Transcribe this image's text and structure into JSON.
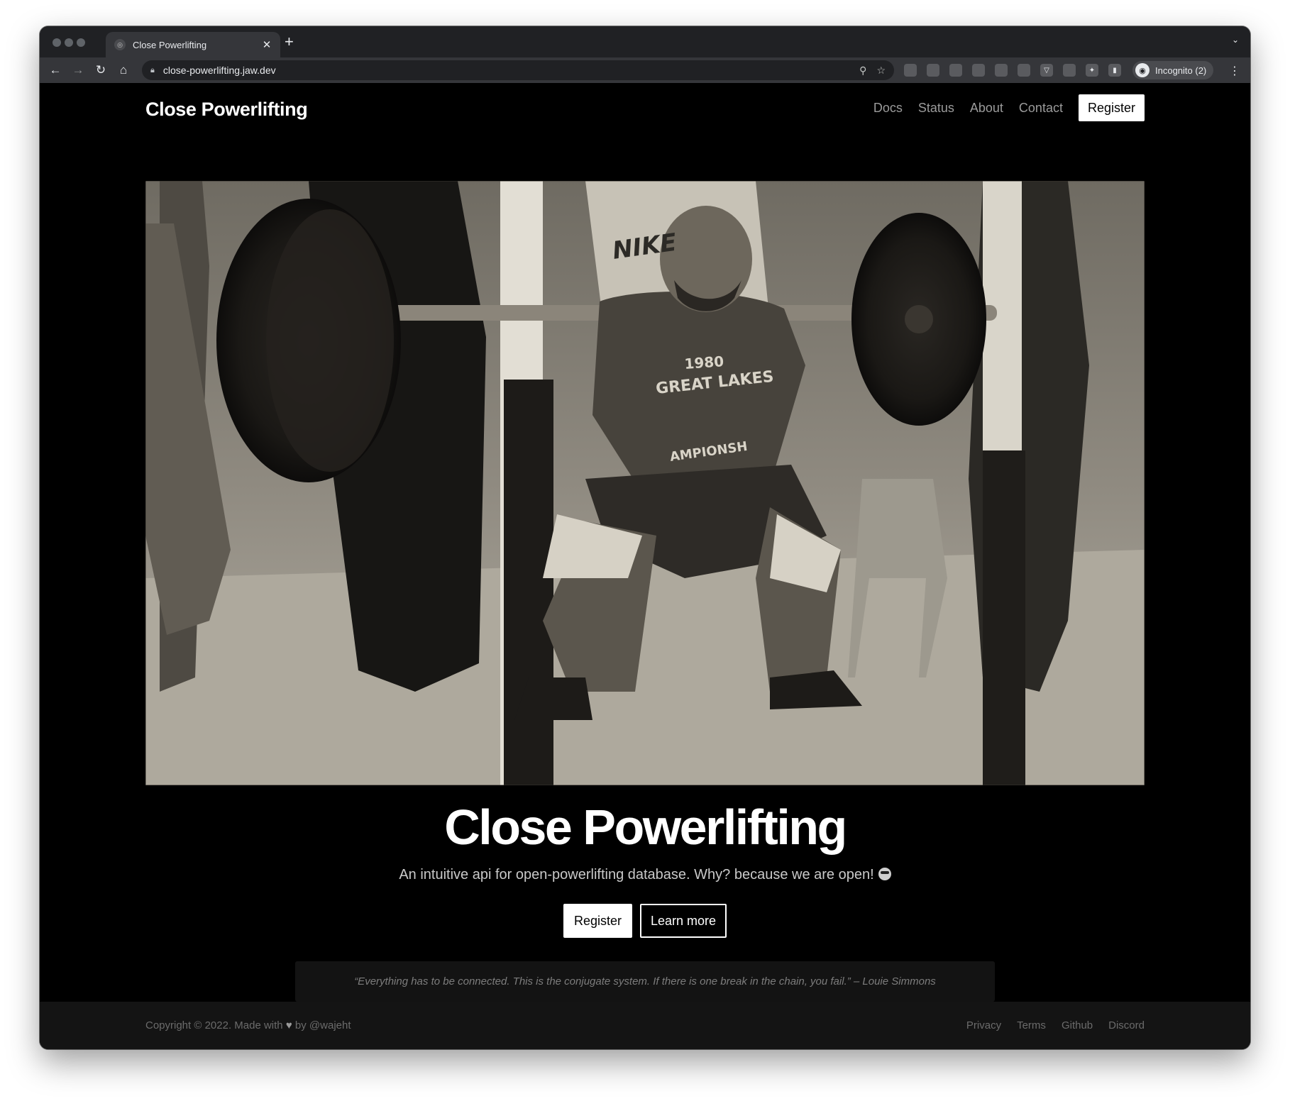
{
  "browser": {
    "tab_title": "Close Powerlifting",
    "url": "close-powerlifting.jaw.dev",
    "incognito_label": "Incognito (2)",
    "icons": {
      "back": "arrow-left-icon",
      "forward": "arrow-right-icon",
      "reload": "reload-icon",
      "home": "home-icon",
      "lock": "lock-icon",
      "zoom": "magnifier-icon",
      "bookmark": "star-icon",
      "extensions": "puzzle-icon",
      "sidepanel": "side-panel-icon",
      "menu": "kebab-menu-icon"
    }
  },
  "header": {
    "brand": "Close Powerlifting",
    "nav": [
      "Docs",
      "Status",
      "About",
      "Contact"
    ],
    "register": "Register"
  },
  "hero": {
    "image_text": {
      "year": "1980",
      "line1": "GREAT LAKES",
      "line2": "AMPIONSH",
      "shirt_logo": "NIKE"
    },
    "title": "Close Powerlifting",
    "subtitle": "An intuitive api for open-powerlifting database. Why? because we are open!",
    "subtitle_emoji": "sunglasses-emoji-icon",
    "primary_button": "Register",
    "secondary_button": "Learn more"
  },
  "quote": "“Everything has to be connected. This is the conjugate system. If there is one break in the chain, you fail.” – Louie Simmons",
  "footer": {
    "copyright_prefix": "Copyright © 2022. Made with",
    "copyright_suffix": "by @wajeht",
    "links": [
      "Privacy",
      "Terms",
      "Github",
      "Discord"
    ]
  },
  "colors": {
    "page_bg": "#000000",
    "browser_chrome": "#202124",
    "toolbar": "#35363a",
    "muted_text": "#9b9b9b",
    "quote_bg": "#131313",
    "footer_bg": "#141414"
  }
}
